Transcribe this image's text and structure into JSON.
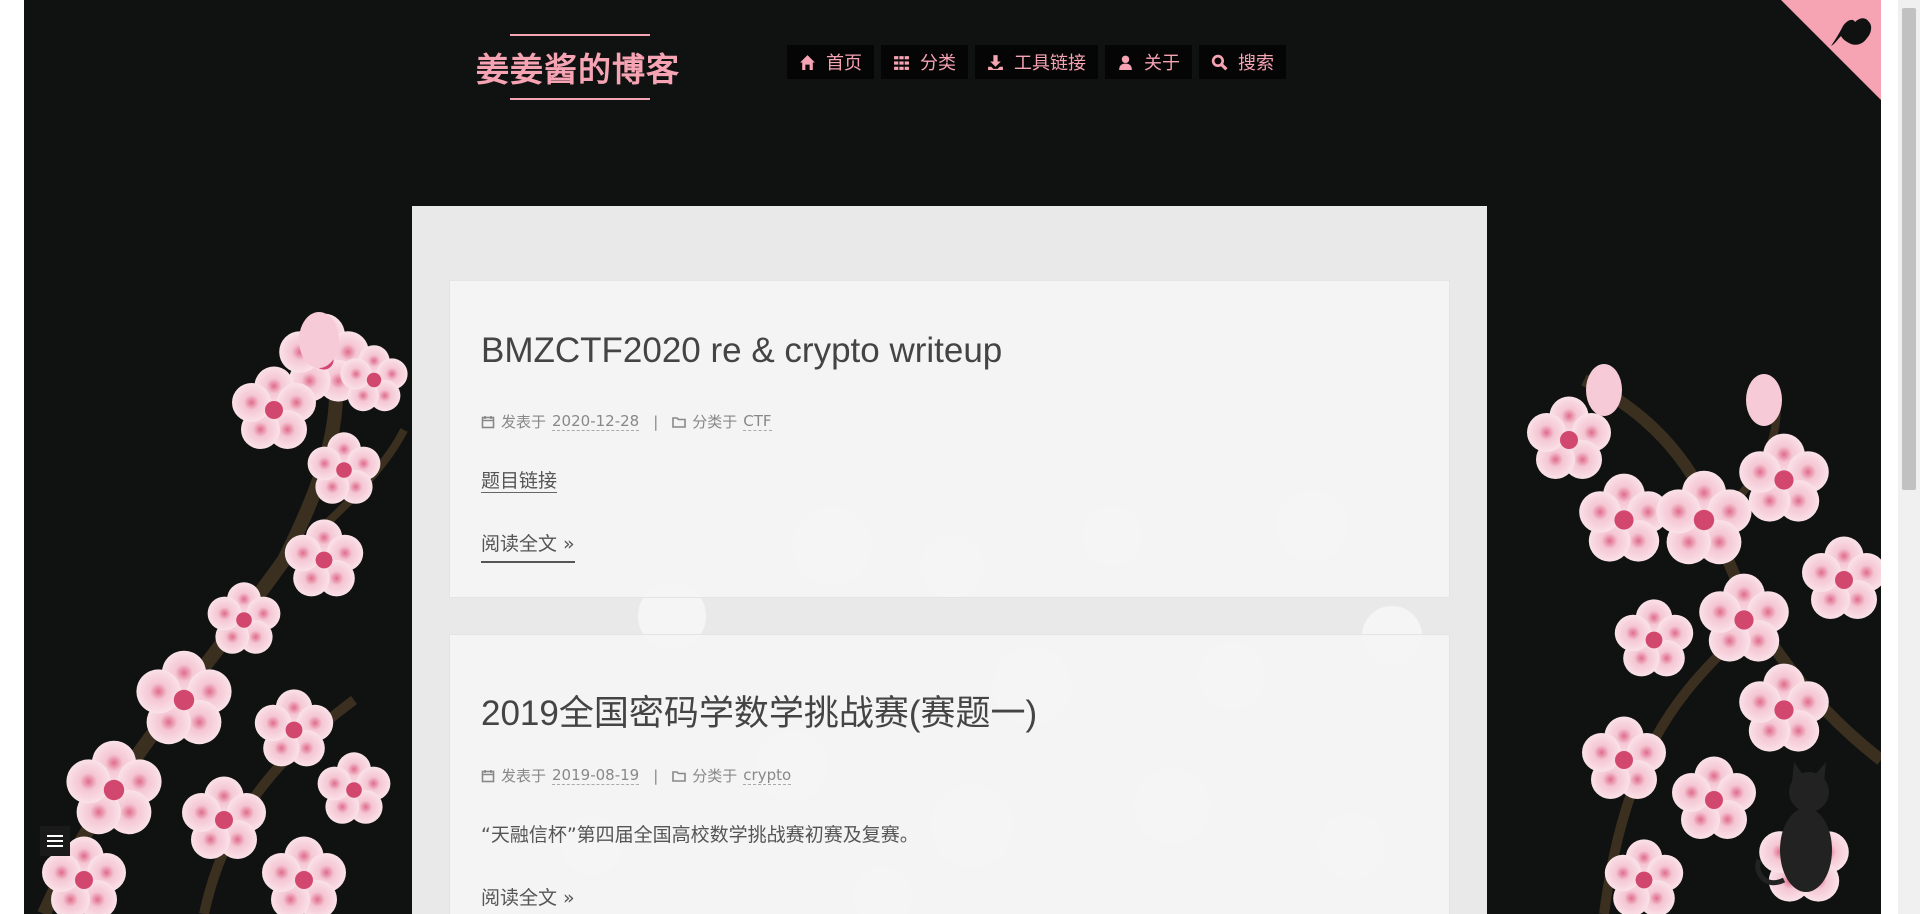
{
  "header": {
    "brand_title": "姜姜酱的博客",
    "nav": [
      {
        "icon": "home-icon",
        "label": "首页"
      },
      {
        "icon": "grid-icon",
        "label": "分类"
      },
      {
        "icon": "download-icon",
        "label": "工具链接"
      },
      {
        "icon": "user-icon",
        "label": "关于"
      },
      {
        "icon": "search-icon",
        "label": "搜索"
      }
    ]
  },
  "posts": [
    {
      "title": "BMZCTF2020 re & crypto writeup",
      "posted_label": "发表于",
      "date": "2020-12-28",
      "category_label": "分类于",
      "category": "CTF",
      "excerpt": "题目链接",
      "read_more": "阅读全文 »"
    },
    {
      "title": "2019全国密码学数学挑战赛(赛题一)",
      "posted_label": "发表于",
      "date": "2019-08-19",
      "category_label": "分类于",
      "category": "crypto",
      "excerpt": "“天融信杯”第四届全国高校数学挑战赛初赛及复赛。",
      "read_more": "阅读全文 »"
    }
  ],
  "separator": "|",
  "colors": {
    "accent": "#f6a3b3",
    "background": "#101211",
    "card": "#f4f4f4",
    "text": "#444444"
  }
}
